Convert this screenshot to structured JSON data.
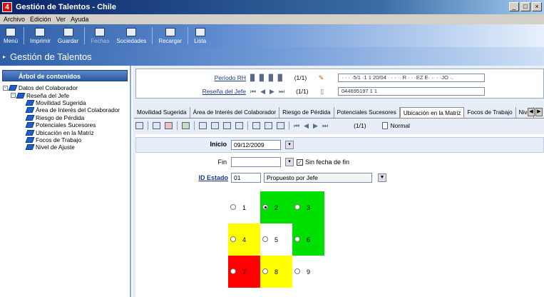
{
  "window": {
    "title": "Gestión de Talentos - Chile",
    "buttons": [
      "_",
      "□",
      "×"
    ]
  },
  "menu": [
    "Archivo",
    "Edición",
    "Ver",
    "Ayuda"
  ],
  "toolbar": [
    {
      "label": "Menú",
      "icon": "menu-icon",
      "enabled": true
    },
    {
      "label": "Imprimir",
      "icon": "printer-icon",
      "enabled": true
    },
    {
      "label": "Guardar",
      "icon": "save-icon",
      "enabled": true
    },
    {
      "label": "Fechas",
      "icon": "calendar-icon",
      "enabled": false
    },
    {
      "label": "Sociedades",
      "icon": "companies-icon",
      "enabled": true
    },
    {
      "label": "Recargar",
      "icon": "refresh-icon",
      "enabled": true
    },
    {
      "label": "Lista",
      "icon": "list-icon",
      "enabled": true
    }
  ],
  "app_header": {
    "title": "Gestión de Talentos"
  },
  "tree": {
    "header": "Árbol de contenidos",
    "items": [
      {
        "label": "Datos del Colaborador",
        "level": 0,
        "expander": "-"
      },
      {
        "label": "Reseña del Jefe",
        "level": 1,
        "expander": "-"
      },
      {
        "label": "Movilidad Sugerida",
        "level": 2,
        "expander": ""
      },
      {
        "label": "Área de Interés del Colaborador",
        "level": 2,
        "expander": ""
      },
      {
        "label": "Riesgo de Pérdida",
        "level": 2,
        "expander": ""
      },
      {
        "label": "Potenciales Sucesores",
        "level": 2,
        "expander": ""
      },
      {
        "label": "Ubicación en la Matriz",
        "level": 2,
        "expander": ""
      },
      {
        "label": "Focos de Trabajo",
        "level": 2,
        "expander": ""
      },
      {
        "label": "Nivel de Ajuste",
        "level": 2,
        "expander": ""
      }
    ]
  },
  "header_panel": {
    "periodo": {
      "label": "Período RH",
      "count": "(1/1)",
      "value": "· · · ·5/1 ·1 1 20/04 · · · ·· R · · ·EZ E· ·· ·  ·JO ·."
    },
    "resena": {
      "label": "Reseña del Jefe",
      "count": "(1/1)",
      "value": "044695197  1  1"
    }
  },
  "tabs": [
    "Movilidad Sugerida",
    "Área de Interés del Colaborador",
    "Riesgo de Pérdida",
    "Potenciales Sucesores",
    "Ubicación en la Matriz",
    "Focos de Trabajo",
    "Nive"
  ],
  "active_tab": "Ubicación en la Matriz",
  "form_toolbar": {
    "count": "(1/1)",
    "mode": "Normal"
  },
  "form": {
    "inicio_label": "Inicio",
    "inicio_value": "09/12/2009",
    "fin_label": "Fin",
    "fin_value": "",
    "sin_fecha_label": "Sin fecha de fin",
    "sin_fecha_checked": true,
    "id_estado_label": "ID Estado",
    "id_estado_value": "01",
    "estado_desc": "Propuesto por Jefe"
  },
  "matrix": {
    "colors": {
      "green": "#00e000",
      "yellow": "#ffff00",
      "red": "#ff0000",
      "white": "#ffffff"
    },
    "cells": [
      {
        "n": "1",
        "color": "white",
        "selected": false
      },
      {
        "n": "2",
        "color": "green",
        "selected": true
      },
      {
        "n": "3",
        "color": "green",
        "selected": false
      },
      {
        "n": "4",
        "color": "yellow",
        "selected": false
      },
      {
        "n": "5",
        "color": "white",
        "selected": false
      },
      {
        "n": "6",
        "color": "green",
        "selected": false
      },
      {
        "n": "7",
        "color": "red",
        "selected": false
      },
      {
        "n": "8",
        "color": "yellow",
        "selected": false
      },
      {
        "n": "9",
        "color": "white",
        "selected": false
      }
    ]
  }
}
